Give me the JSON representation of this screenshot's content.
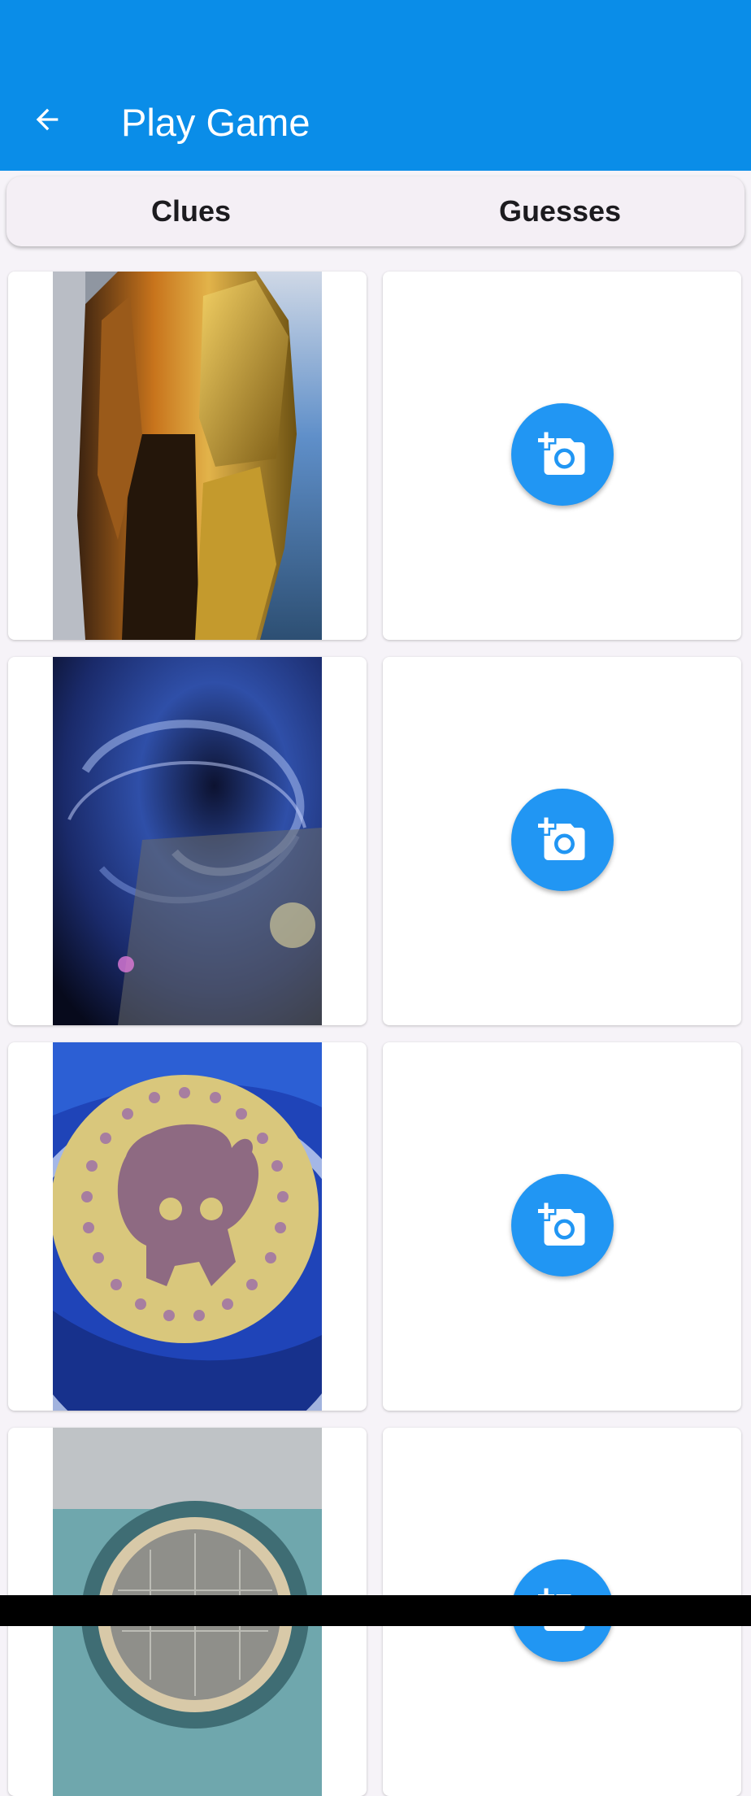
{
  "app_bar": {
    "title": "Play Game",
    "back_icon": "arrow-back-icon",
    "color": "#0a8de8"
  },
  "tabs": [
    {
      "label": "Clues"
    },
    {
      "label": "Guesses"
    }
  ],
  "rows": [
    {
      "clue_image": "gold-faceted-vase-photo",
      "guess_action_icon": "add-a-photo-icon"
    },
    {
      "clue_image": "galaxy-swirl-photo",
      "guess_action_icon": "add-a-photo-icon"
    },
    {
      "clue_image": "skull-emblem-photo",
      "guess_action_icon": "add-a-photo-icon"
    },
    {
      "clue_image": "car-headlight-photo",
      "guess_action_icon": "add-a-photo-icon"
    }
  ],
  "colors": {
    "fab": "#2196f3",
    "background": "#f6f3f8"
  }
}
